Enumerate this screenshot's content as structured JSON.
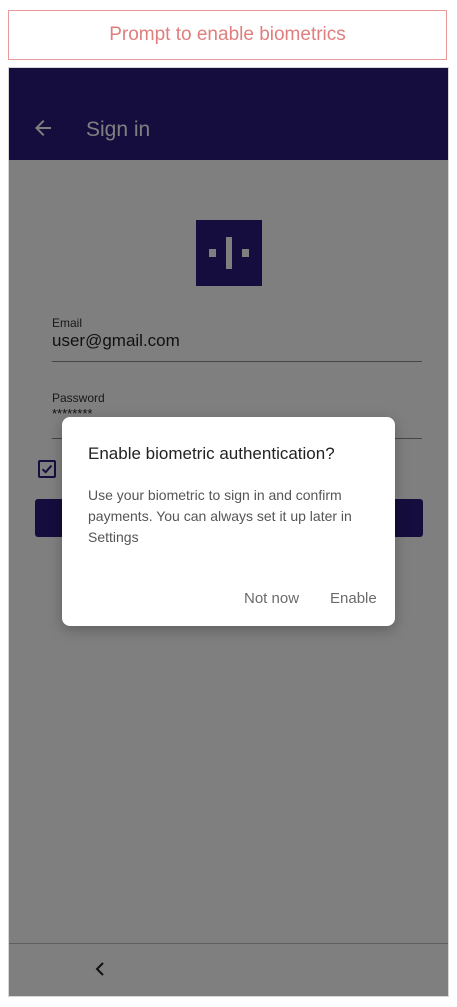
{
  "caption": "Prompt to enable biometrics",
  "appbar": {
    "title": "Sign in"
  },
  "form": {
    "email_label": "Email",
    "email_value": "user@gmail.com",
    "password_label": "Password",
    "password_value": "********"
  },
  "dialog": {
    "title": "Enable biometric authentication?",
    "body": "Use your biometric to sign in and confirm payments. You can always set it up later in Settings",
    "secondary_action": "Not now",
    "primary_action": "Enable"
  },
  "colors": {
    "brand": "#2a1b7a",
    "caption_accent": "#e07e7e"
  },
  "icons": {
    "back": "arrow-left",
    "logo": "app-logo",
    "checkbox": "check",
    "nav_back": "chevron-left"
  }
}
